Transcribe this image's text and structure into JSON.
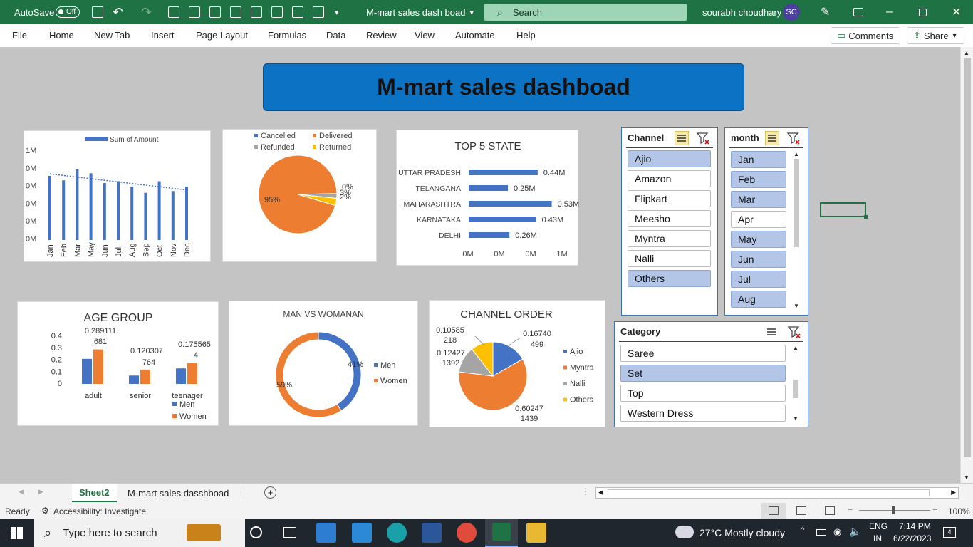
{
  "titlebar": {
    "autosave_label": "AutoSave",
    "autosave_state": "Off",
    "doc_title": "M-mart sales dash boad",
    "search_placeholder": "Search",
    "user_name": "sourabh choudhary",
    "user_initials": "SC"
  },
  "menu": {
    "items": [
      "File",
      "Home",
      "New Tab",
      "Insert",
      "Page Layout",
      "Formulas",
      "Data",
      "Review",
      "View",
      "Automate",
      "Help"
    ],
    "comments_label": "Comments",
    "share_label": "Share"
  },
  "dashboard": {
    "title": "M-mart sales dashboad",
    "accent_color": "#0b72c4"
  },
  "charts": {
    "monthly": {
      "legend": "Sum of Amount"
    },
    "status": {
      "legend": [
        "Cancelled",
        "Delivered",
        "Refunded",
        "Returned"
      ]
    },
    "top_states": {
      "title": "TOP 5 STATE"
    },
    "age_group": {
      "title": "AGE GROUP",
      "legend": [
        "Men",
        "Women"
      ]
    },
    "gender": {
      "title": "MAN VS WOMANAN",
      "legend": [
        "Men",
        "Women"
      ]
    },
    "channel_order": {
      "title": "CHANNEL ORDER",
      "legend": [
        "Ajio",
        "Myntra",
        "Nalli",
        "Others"
      ]
    }
  },
  "chart_data": [
    {
      "type": "bar",
      "categories": [
        "Jan",
        "Feb",
        "Mar",
        "May",
        "Jun",
        "Jul",
        "Aug",
        "Sep",
        "Oct",
        "Nov",
        "Dec"
      ],
      "series": [
        {
          "name": "Sum of Amount",
          "values": [
            0.72,
            0.67,
            0.8,
            0.75,
            0.64,
            0.66,
            0.6,
            0.53,
            0.66,
            0.55,
            0.6
          ]
        }
      ],
      "yticks": [
        "1M",
        "0M",
        "0M",
        "0M",
        "0M",
        "0M"
      ],
      "trendline": "linear",
      "grid": false,
      "legend": "top"
    },
    {
      "type": "pie",
      "categories": [
        "Cancelled",
        "Delivered",
        "Refunded",
        "Returned"
      ],
      "values": [
        0,
        95,
        2,
        3
      ],
      "labels": [
        "0%",
        "95%",
        "2%",
        "3%"
      ],
      "legend": "top"
    },
    {
      "type": "bar",
      "orientation": "horizontal",
      "title": "TOP 5 STATE",
      "categories": [
        "UTTAR PRADESH",
        "TELANGANA",
        "MAHARASHTRA",
        "KARNATAKA",
        "DELHI"
      ],
      "values": [
        0.44,
        0.25,
        0.53,
        0.43,
        0.26
      ],
      "data_labels": [
        "0.44M",
        "0.25M",
        "0.53M",
        "0.43M",
        "0.26M"
      ],
      "xticks": [
        "0M",
        "0M",
        "0M",
        "1M"
      ]
    },
    {
      "type": "bar",
      "title": "AGE GROUP",
      "categories": [
        "adult",
        "senior",
        "teenager"
      ],
      "series": [
        {
          "name": "Men",
          "values": [
            0.21,
            0.07,
            0.13
          ]
        },
        {
          "name": "Women",
          "values": [
            0.289111681,
            0.120307764,
            0.1755654
          ]
        }
      ],
      "data_labels": [
        "0.289111 681",
        "0.120307 764",
        "0.175565 4"
      ],
      "yticks": [
        "0.4",
        "0.3",
        "0.2",
        "0.1",
        "0"
      ],
      "legend": "bottom-right"
    },
    {
      "type": "pie",
      "subtype": "doughnut",
      "title": "MAN VS WOMANAN",
      "categories": [
        "Men",
        "Women"
      ],
      "values": [
        41,
        59
      ],
      "labels": [
        "41%",
        "59%"
      ],
      "legend": "right"
    },
    {
      "type": "pie",
      "title": "CHANNEL ORDER",
      "categories": [
        "Ajio",
        "Myntra",
        "Nalli",
        "Others"
      ],
      "values": [
        0.16740499,
        0.602471439,
        0.124271392,
        0.10585218
      ],
      "labels": [
        "0.16740 499",
        "0.60247 1439",
        "0.12427 1392",
        "0.10585 218"
      ],
      "legend": "right"
    }
  ],
  "slicers": {
    "channel": {
      "title": "Channel",
      "items": [
        {
          "label": "Ajio",
          "selected": true
        },
        {
          "label": "Amazon",
          "selected": false
        },
        {
          "label": "Flipkart",
          "selected": false
        },
        {
          "label": "Meesho",
          "selected": false
        },
        {
          "label": "Myntra",
          "selected": false
        },
        {
          "label": "Nalli",
          "selected": false
        },
        {
          "label": "Others",
          "selected": true
        }
      ]
    },
    "month": {
      "title": "month",
      "items": [
        {
          "label": "Jan",
          "selected": true
        },
        {
          "label": "Feb",
          "selected": true
        },
        {
          "label": "Mar",
          "selected": true
        },
        {
          "label": "Apr",
          "selected": false
        },
        {
          "label": "May",
          "selected": true
        },
        {
          "label": "Jun",
          "selected": true
        },
        {
          "label": "Jul",
          "selected": true
        },
        {
          "label": "Aug",
          "selected": true
        }
      ]
    },
    "category": {
      "title": "Category",
      "items": [
        {
          "label": "Saree",
          "selected": false
        },
        {
          "label": "Set",
          "selected": true
        },
        {
          "label": "Top",
          "selected": false
        },
        {
          "label": "Western Dress",
          "selected": false
        }
      ]
    }
  },
  "tabs": {
    "items": [
      "Sheet2",
      "M-mart sales dasshboad"
    ],
    "active": "Sheet2"
  },
  "status": {
    "ready": "Ready",
    "accessibility": "Accessibility: Investigate",
    "zoom": "100%"
  },
  "taskbar": {
    "search_placeholder": "Type here to search",
    "weather": "27°C  Mostly cloudy",
    "lang_top": "ENG",
    "lang_bottom": "IN",
    "time": "7:14 PM",
    "date": "6/22/2023",
    "notifications": "4"
  }
}
